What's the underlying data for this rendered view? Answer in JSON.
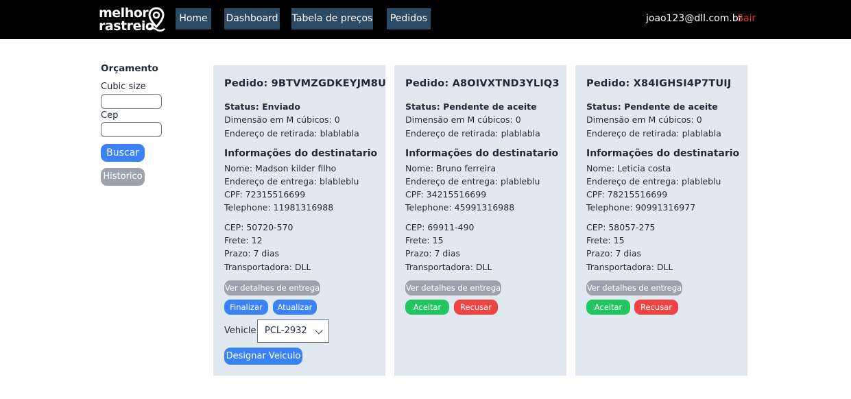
{
  "brand": {
    "line1": "melhor",
    "line2": "rastreio"
  },
  "nav": {
    "home": "Home",
    "dashboard": "Dashboard",
    "tabela": "Tabela de preços",
    "pedidos": "Pedidos"
  },
  "user": {
    "email": "joao123@dll.com.br",
    "logout": "Sair"
  },
  "colors": {
    "logout": "#ef2b2b",
    "nav_bg": "#2b4a66",
    "card_bg": "#e2e8f0",
    "primary": "#3b82f6",
    "accept": "#22c55e",
    "reject": "#ef4444"
  },
  "sidebar": {
    "title": "Orçamento",
    "cubic_label": "Cubic size",
    "cubic_value": "",
    "cep_label": "Cep",
    "cep_value": "",
    "buscar": "Buscar",
    "historico": "Historico"
  },
  "orders": [
    {
      "title": "Pedido: 9BTVMZGDKEYJM8U",
      "status": "Status: Enviado",
      "dimensao": "Dimensão em M cúbicos: 0",
      "retirada": "Endereço de retirada: blablabla",
      "section": "Informações do destinatario",
      "nome": "Nome: Madson kilder filho",
      "entrega": "Endereço de entrega: blableblu",
      "cpf": "CPF: 72315516699",
      "telephone": "Telephone: 11981316988",
      "cep": "CEP: 50720-570",
      "frete": "Frete: 12",
      "prazo": "Prazo: 7 dias",
      "transportadora": "Transportadora: DLL",
      "detalhes": "Ver detalhes de entrega",
      "finalizar": "Finalizar",
      "atualizar": "Atualizar",
      "vehicle_label": "Vehicle",
      "vehicle_value": "PCL-2932",
      "designar": "Designar Veiculo"
    },
    {
      "title": "Pedido: A8OIVXTND3YLIQ3",
      "status": "Status: Pendente de aceite",
      "dimensao": "Dimensão em M cúbicos: 0",
      "retirada": "Endereço de retirada: plablabla",
      "section": "Informações do destinatario",
      "nome": "Nome: Bruno ferreira",
      "entrega": "Endereço de entrega: plableblu",
      "cpf": "CPF: 34215516699",
      "telephone": "Telephone: 45991316988",
      "cep": "CEP: 69911-490",
      "frete": "Frete: 15",
      "prazo": "Prazo: 7 dias",
      "transportadora": "Transportadora: DLL",
      "detalhes": "Ver detalhes de entrega",
      "aceitar": "Aceitar",
      "recusar": "Recusar"
    },
    {
      "title": "Pedido: X84IGHSI4P7TUIJ",
      "status": "Status: Pendente de aceite",
      "dimensao": "Dimensão em M cúbicos: 0",
      "retirada": "Endereço de retirada: plablabla",
      "section": "Informações do destinatario",
      "nome": "Nome: Leticia costa",
      "entrega": "Endereço de entrega: plableblu",
      "cpf": "CPF: 78215516699",
      "telephone": "Telephone: 90991316977",
      "cep": "CEP: 58057-275",
      "frete": "Frete: 15",
      "prazo": "Prazo: 7 dias",
      "transportadora": "Transportadora: DLL",
      "detalhes": "Ver detalhes de entrega",
      "aceitar": "Aceitar",
      "recusar": "Recusar"
    }
  ]
}
